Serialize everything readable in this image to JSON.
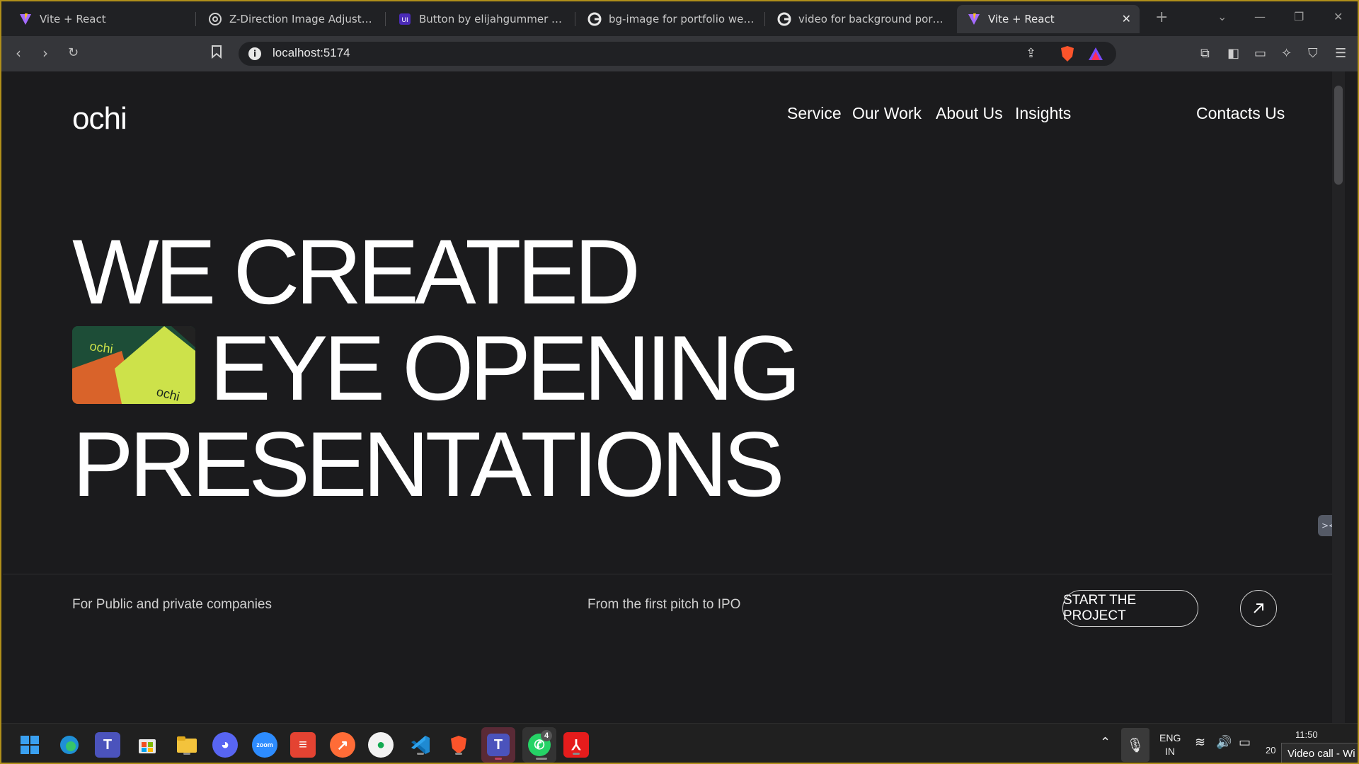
{
  "browser": {
    "tabs": [
      {
        "label": "Vite + React",
        "icon": "vite-icon"
      },
      {
        "label": "Z-Direction Image Adjustment",
        "icon": "openai-icon"
      },
      {
        "label": "Button by elijahgummer made",
        "icon": "uiverse-icon"
      },
      {
        "label": "bg-image for portfolio website",
        "icon": "google-icon"
      },
      {
        "label": "video for background portfolio",
        "icon": "google-icon"
      },
      {
        "label": "Vite + React",
        "icon": "vite-icon",
        "active": true
      }
    ],
    "url": "localhost:5174"
  },
  "site": {
    "logo": "ochi",
    "nav": [
      "Service",
      "Our Work",
      "About Us",
      "Insights"
    ],
    "contact": "Contacts Us",
    "hero": {
      "line1": "WE CREATED",
      "line2": "EYE OPENING",
      "line3": "PRESENTATIONS",
      "image_text": "ochi"
    },
    "tagline_left": "For Public and private companies",
    "tagline_mid": "From the first pitch to IPO",
    "cta": "START THE PROJECT"
  },
  "taskbar": {
    "apps": [
      "windows-start",
      "edge",
      "teams",
      "store",
      "file-explorer",
      "discord",
      "zoom",
      "todoist",
      "postman",
      "mongodb-compass",
      "vscode",
      "brave",
      "teams-active",
      "whatsapp",
      "acrobat"
    ],
    "whatsapp_badge": "4",
    "zoom_label": "zoom",
    "lang": "ENG",
    "region": "IN",
    "time": "11:50",
    "date_partial": "20",
    "notification": "Video call - Wi"
  },
  "colors": {
    "page_bg": "#1b1b1d",
    "accent_green": "#cddc39",
    "accent_orange": "#e06a2c",
    "frame_border": "#b08f1a"
  }
}
